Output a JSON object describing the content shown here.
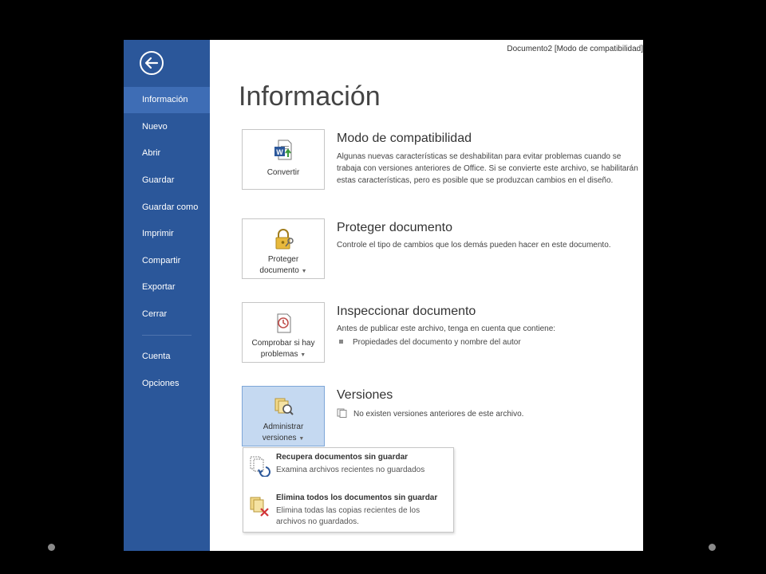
{
  "window": {
    "title": "Documento2 [Modo de compatibilidad]"
  },
  "sidebar": {
    "items": [
      {
        "label": "Información"
      },
      {
        "label": "Nuevo"
      },
      {
        "label": "Abrir"
      },
      {
        "label": "Guardar"
      },
      {
        "label": "Guardar como"
      },
      {
        "label": "Imprimir"
      },
      {
        "label": "Compartir"
      },
      {
        "label": "Exportar"
      },
      {
        "label": "Cerrar"
      },
      {
        "label": "Cuenta"
      },
      {
        "label": "Opciones"
      }
    ]
  },
  "main": {
    "title": "Información",
    "sections": [
      {
        "button_label": "Convertir",
        "title": "Modo de compatibilidad",
        "text": "Algunas nuevas características se deshabilitan para evitar problemas cuando se trabaja con versiones anteriores de Office. Si se convierte este archivo, se habilitarán estas características, pero es posible que se produzcan cambios en el diseño."
      },
      {
        "button_label_1": "Proteger",
        "button_label_2": "documento",
        "title": "Proteger documento",
        "text": "Controle el tipo de cambios que los demás pueden hacer en este documento."
      },
      {
        "button_label_1": "Comprobar si hay",
        "button_label_2": "problemas",
        "title": "Inspeccionar documento",
        "text": "Antes de publicar este archivo, tenga en cuenta que contiene:",
        "bullet": "Propiedades del documento y nombre del autor"
      },
      {
        "button_label_1": "Administrar",
        "button_label_2": "versiones",
        "title": "Versiones",
        "text": "No existen versiones anteriores de este archivo."
      }
    ]
  },
  "dropdown": {
    "items": [
      {
        "title": "Recupera documentos sin guardar",
        "desc": "Examina archivos recientes no guardados"
      },
      {
        "title": "Elimina todos los documentos sin guardar",
        "desc": "Elimina todas las copias recientes de los archivos no guardados."
      }
    ]
  },
  "colors": {
    "sidebar": "#2b579a",
    "sidebar_active": "#3e6db5",
    "selected_button": "#c5d9f1"
  }
}
